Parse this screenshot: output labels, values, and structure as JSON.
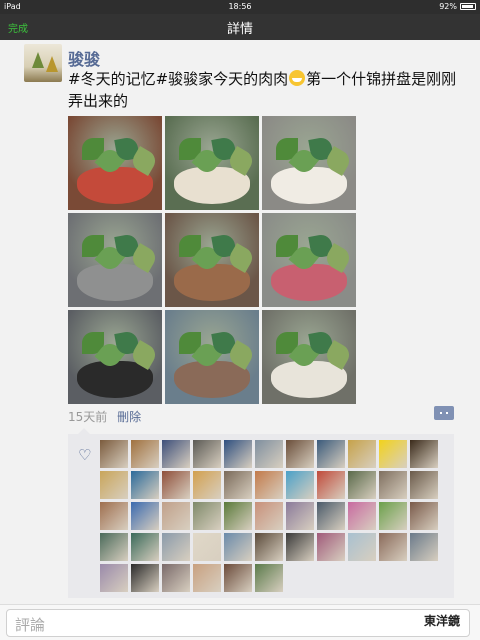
{
  "status_bar": {
    "device": "iPad",
    "time": "18:56",
    "battery": "92%",
    "battery_level": 0.92
  },
  "nav": {
    "done_label": "完成",
    "title": "詳情"
  },
  "post": {
    "author": "骏骏",
    "text_before_emoji": "#冬天的记忆#骏骏家今天的肉肉",
    "emoji": "grinning-face-icon",
    "text_after_emoji": "第一个什锦拼盘是刚刚弄出来的",
    "photo_colors": [
      "#7a4a36",
      "#5a6e52",
      "#8b8a86",
      "#6d6f73",
      "#6b5648",
      "#8a8c88",
      "#5b5e63",
      "#6a7e8c",
      "#6f7068"
    ],
    "time_ago": "15天前",
    "delete_label": "刪除"
  },
  "likes": {
    "heart_icon": "heart-icon",
    "avatar_colors": [
      "#7b5b3d",
      "#a0713f",
      "#3d4f7a",
      "#5b5a55",
      "#2f4f7f",
      "#7f8f9f",
      "#6a4e3a",
      "#3a5a7b",
      "#c6a24a",
      "#f2d21a",
      "#3a2a1a",
      "#c9a55a",
      "#2a6a9a",
      "#8f4f3a",
      "#d2a04f",
      "#7a6a5a",
      "#c27a4a",
      "#4aa0c8",
      "#c04a3a",
      "#5a6a4a",
      "#7f6f5f",
      "#6a5a4a",
      "#9f6f4f",
      "#3a6aaf",
      "#c0a08a",
      "#7f8a6a",
      "#5a7a3a",
      "#c8907a",
      "#8a7a9a",
      "#4a5a6a",
      "#c86aa0",
      "#6aa04a",
      "#7a5a4a",
      "#4a6a5a",
      "#3a6a5a",
      "#8a9aaa",
      "#e0d8c8",
      "#6a8aaa",
      "#5a4a3a",
      "#3a3a3a",
      "#a05a7a",
      "#a8c0d0",
      "#8a6a5a",
      "#6a7a8a",
      "#9a8aaa",
      "#2a2a2a",
      "#7a6a6a",
      "#c8a080",
      "#6a4a3a",
      "#5a7a4a"
    ]
  },
  "comment_bar": {
    "placeholder": "評論",
    "watermark": "東洋鏡"
  }
}
